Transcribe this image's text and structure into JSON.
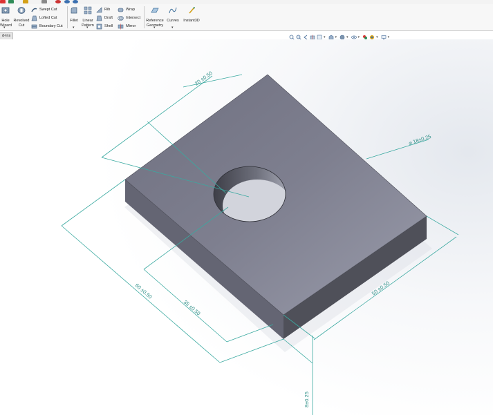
{
  "ribbon": {
    "col1": {
      "hole_wizard_label_1": "Hole",
      "hole_wizard_label_2": "Wizard"
    },
    "col2": {
      "revolved_cut_label_1": "Revolved",
      "revolved_cut_label_2": "Cut"
    },
    "col3": {
      "swept_cut": "Swept Cut",
      "lofted_cut": "Lofted Cut",
      "boundary_cut": "Boundary Cut"
    },
    "col4": {
      "fillet": "Fillet"
    },
    "col5": {
      "linear_pattern_1": "Linear",
      "linear_pattern_2": "Pattern"
    },
    "col6": {
      "rib": "Rib",
      "draft": "Draft",
      "shell": "Shell"
    },
    "col7": {
      "wrap": "Wrap",
      "intersect": "Intersect",
      "mirror": "Mirror"
    },
    "col8": {
      "reference_geometry_1": "Reference",
      "reference_geometry_2": "Geometry"
    },
    "col9": {
      "curves": "Curves"
    },
    "col10": {
      "instant3d": "Instant3D"
    }
  },
  "command_manager": {
    "tab_label": "d-Ins"
  },
  "drawing": {
    "dim_top": "20 ±0.50",
    "dim_hole_dia": "⌀ 18±0.25",
    "dim_right": "50 ±0.50",
    "dim_left_outer": "60 ±0.50",
    "dim_left_inner": "35 ±0.50",
    "dim_thickness": "8±0.25"
  },
  "colors": {
    "dimension_line": "#3aa9a0",
    "part_top": "#7c7d8d",
    "part_side_front": "#50515b",
    "part_side_left": "#6b6c78"
  }
}
